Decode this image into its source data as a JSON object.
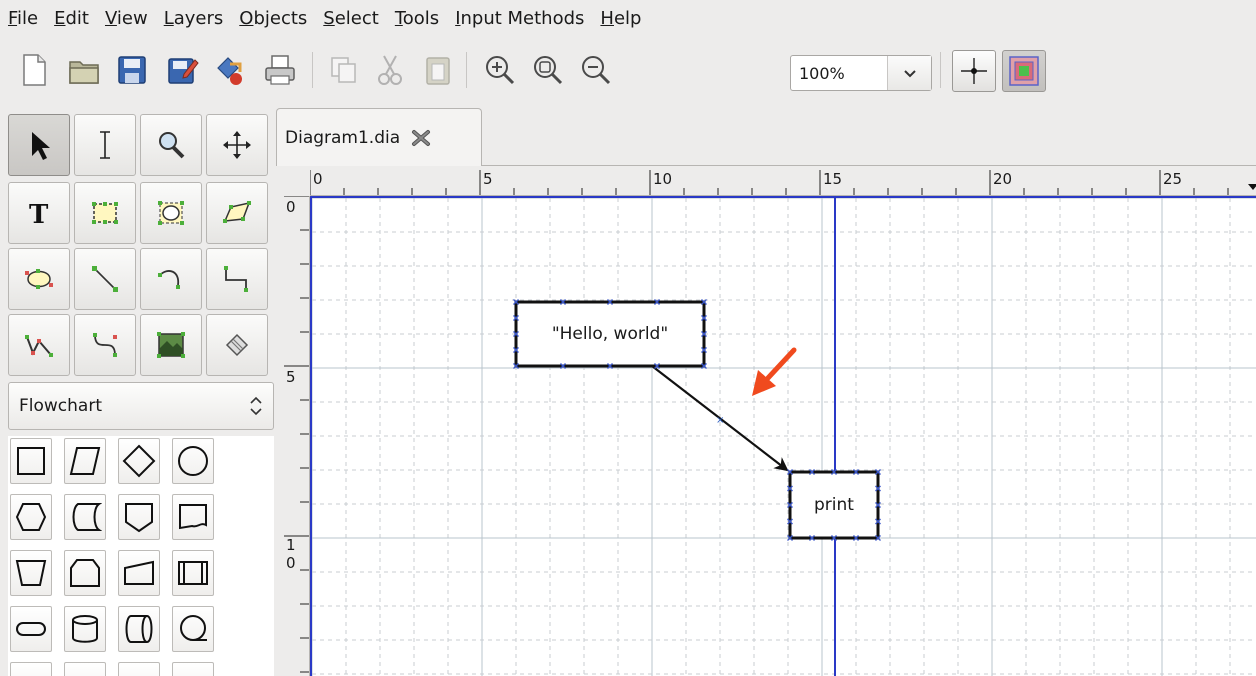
{
  "menubar": {
    "items": [
      {
        "label": "File",
        "mnemonic": "F",
        "rest": "ile"
      },
      {
        "label": "Edit",
        "mnemonic": "E",
        "rest": "dit"
      },
      {
        "label": "View",
        "mnemonic": "V",
        "rest": "iew"
      },
      {
        "label": "Layers",
        "mnemonic": "L",
        "rest": "ayers"
      },
      {
        "label": "Objects",
        "mnemonic": "O",
        "rest": "bjects"
      },
      {
        "label": "Select",
        "mnemonic": "S",
        "rest": "elect"
      },
      {
        "label": "Tools",
        "mnemonic": "T",
        "rest": "ools"
      },
      {
        "label": "Input Methods",
        "mnemonic": "I",
        "rest": "nput Methods"
      },
      {
        "label": "Help",
        "mnemonic": "H",
        "rest": "elp"
      }
    ]
  },
  "toolbar": {
    "zoom_value": "100%",
    "icons": [
      "new-file-icon",
      "open-folder-icon",
      "save-icon",
      "save-as-icon",
      "export-icon",
      "print-icon",
      "copy-icon",
      "cut-icon",
      "paste-icon",
      "zoom-in-icon",
      "zoom-fit-icon",
      "zoom-out-icon",
      "snap-to-grid-icon",
      "snap-to-objects-icon"
    ]
  },
  "tools": [
    "pointer-tool",
    "text-edit-tool",
    "magnify-tool",
    "scroll-tool",
    "text-tool",
    "box-tool",
    "ellipse-tool",
    "polygon-tool",
    "beziergon-tool",
    "line-tool",
    "arc-tool",
    "zigzag-line-tool",
    "polyline-tool",
    "bezier-line-tool",
    "image-tool",
    "outline-tool"
  ],
  "sheet": {
    "selected": "Flowchart"
  },
  "document": {
    "tab_title": "Diagram1.dia",
    "hruler_labels": [
      "0",
      "5",
      "10",
      "15",
      "20",
      "25"
    ],
    "vruler_labels": [
      "0",
      "5",
      "1",
      "0"
    ]
  },
  "diagram": {
    "box1_text": "\"Hello, world\"",
    "box2_text": "print"
  },
  "colors": {
    "guide": "#2a39c6",
    "grid": "#c9cdd2",
    "annotation_arrow": "#f04a1e"
  }
}
